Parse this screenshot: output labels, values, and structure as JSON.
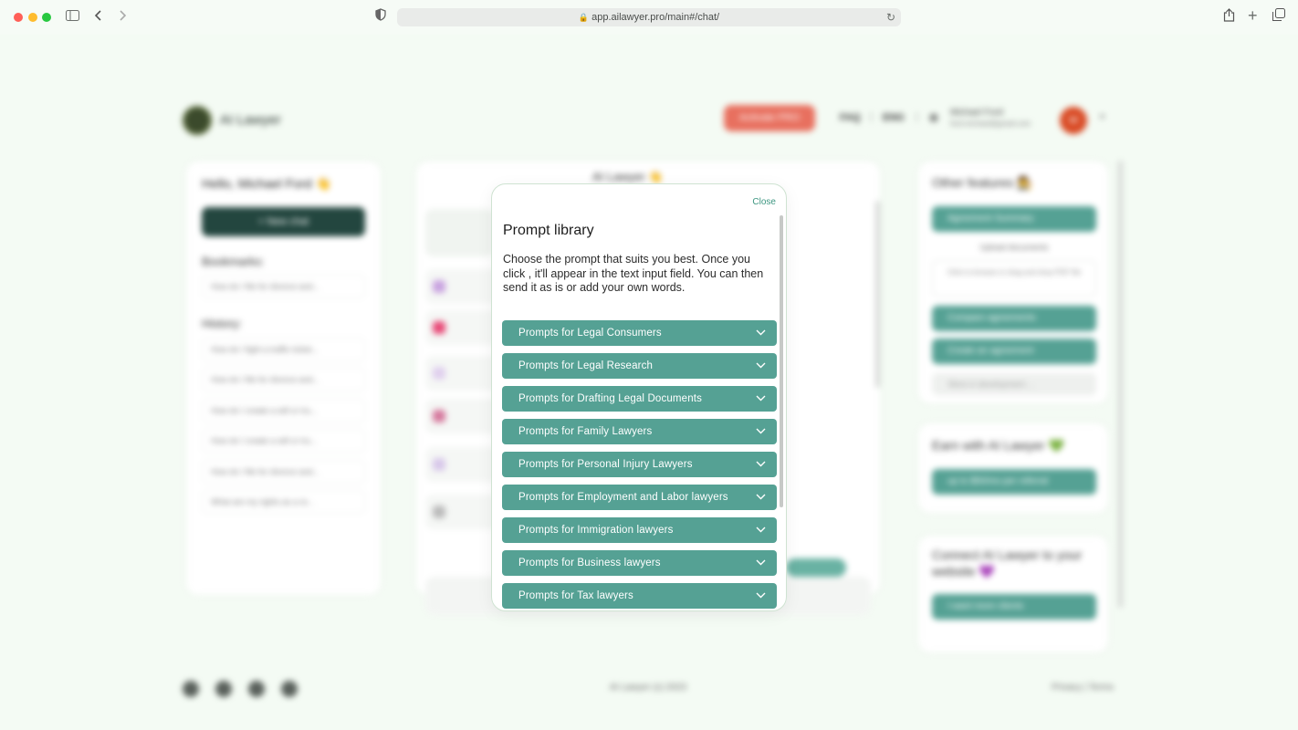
{
  "browser": {
    "url": "app.ailawyer.pro/main#/chat/"
  },
  "app": {
    "logo_text": "AI Lawyer",
    "activate_pro": "Activate PRO",
    "nav_links": [
      "FAQ",
      "ENG"
    ],
    "user_name": "Michael Ford",
    "user_email": "ford.michael@gmail.com",
    "avatar_initial": "M",
    "left": {
      "greeting": "Hello, Michael Ford 👋",
      "new_chat": "+ New chat",
      "bookmarks_label": "Bookmarks:",
      "bookmarks": [
        "How do I file for divorce and..."
      ],
      "history_label": "History:",
      "history": [
        "How do I fight a traffic ticket...",
        "How do I file for divorce and...",
        "How do I create a will or tru...",
        "How do I create a will or tru...",
        "How do I file for divorce and...",
        "What are my rights as a re..."
      ]
    },
    "center": {
      "title": "AI Lawyer 👋"
    },
    "right": {
      "other_features": "Other features 🧑‍⚖️",
      "agreement_summary": "Agreement Summary",
      "upload_documents": "Upload documents",
      "upload_hint": "Click to browse or drag and drop PDF file",
      "compare_agreements": "Compare agreements",
      "create_agreement": "Create an agreement",
      "more_dev": "More in development ...",
      "earn_title": "Earn with AI Lawyer 💚",
      "earn_btn": "up to $50/mo per referral",
      "connect_title": "Connect AI Lawyer to your website 💜",
      "connect_btn": "I want more clients"
    },
    "footer": {
      "copyright": "AI Lawyer (c) 2023",
      "links": "Privacy | Terms"
    }
  },
  "modal": {
    "close": "Close",
    "title": "Prompt library",
    "description": "Choose the prompt that suits you best. Once you click , it'll appear in the text input field. You can then send it as is or add your own words.",
    "accordion": [
      "Prompts for Legal Consumers",
      "Prompts for Legal Research",
      "Prompts for Drafting Legal Documents",
      "Prompts for Family Lawyers",
      "Prompts for Personal Injury Lawyers",
      "Prompts for Employment and Labor lawyers",
      "Prompts for Immigration lawyers",
      "Prompts for Business lawyers",
      "Prompts for Tax lawyers"
    ]
  },
  "colors": {
    "accent": "#55a194",
    "background": "#f4fbf4",
    "pro_button": "#e8705f",
    "close_link": "#3c9680"
  }
}
